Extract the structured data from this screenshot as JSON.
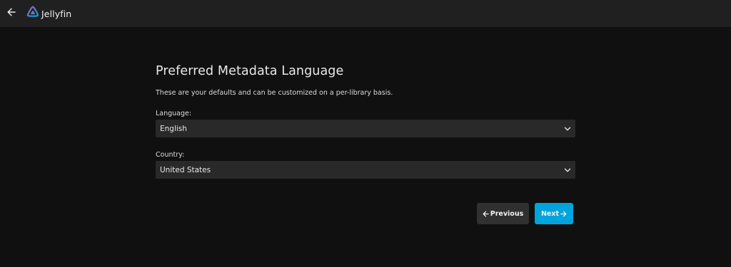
{
  "header": {
    "app_name": "Jellyfin",
    "back_icon": "arrow-left-icon",
    "logo_icon": "jellyfin-logo-icon"
  },
  "wizard": {
    "title": "Preferred Metadata Language",
    "description": "These are your defaults and can be customized on a per-library basis.",
    "language": {
      "label": "Language:",
      "value": "English",
      "icon": "chevron-down-icon"
    },
    "country": {
      "label": "Country:",
      "value": "United States",
      "icon": "chevron-down-icon"
    },
    "previous_label": "Previous",
    "next_label": "Next"
  },
  "colors": {
    "background": "#101010",
    "header": "#202020",
    "select": "#292929",
    "button_secondary": "#303030",
    "accent": "#00a4dc"
  }
}
